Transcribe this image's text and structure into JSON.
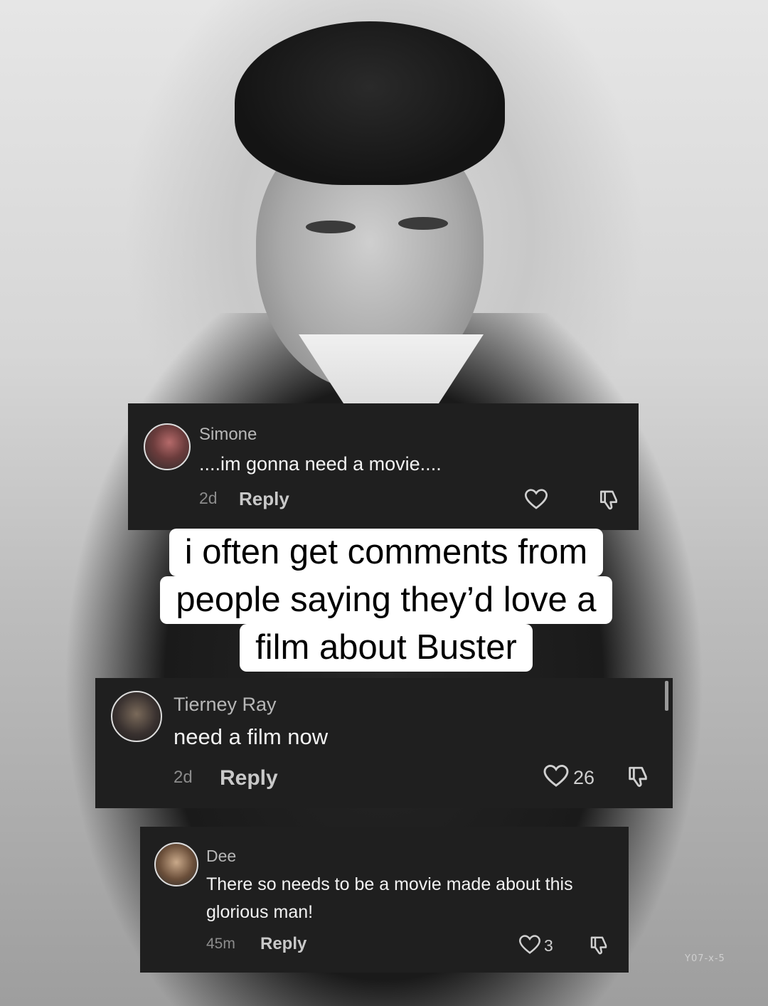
{
  "caption": {
    "line1": "i often get comments from",
    "line2": "people saying they’d love a",
    "line3": "film about Buster"
  },
  "photo_stamp": "Y07-x-5",
  "comments": [
    {
      "name": "Simone",
      "text": "....im gonna need a movie....",
      "age": "2d",
      "reply": "Reply",
      "likes": ""
    },
    {
      "name": "Tierney Ray",
      "text": "need a film now",
      "age": "2d",
      "reply": "Reply",
      "likes": "26"
    },
    {
      "name": "Dee",
      "text": "There so needs to be a movie made about this glorious man!",
      "age": "45m",
      "reply": "Reply",
      "likes": "3"
    }
  ],
  "icons": {
    "like": "heart-outline-icon",
    "dislike": "thumbs-down-icon"
  }
}
